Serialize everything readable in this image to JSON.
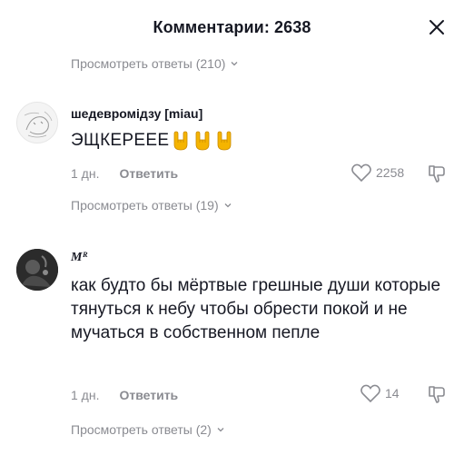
{
  "header": {
    "title": "Комментарии: 2638",
    "close_icon": "close-icon"
  },
  "thread_top": {
    "view_replies": "Просмотреть ответы (210)"
  },
  "comments": [
    {
      "username": "шедевромідзу [miau]",
      "text": "ЭЩКЕРЕЕЕ",
      "emoji": [
        "sign-of-horns",
        "sign-of-horns",
        "sign-of-horns"
      ],
      "time": "1 дн.",
      "reply_label": "Ответить",
      "likes": "2258",
      "view_replies": "Просмотреть ответы (19)"
    },
    {
      "username": "Mᴿ",
      "text": "как будто бы мёртвые грешные души которые тянуться к небу чтобы обрести покой и не мучаться в собственном пепле",
      "time": "1 дн.",
      "reply_label": "Ответить",
      "likes": "14",
      "view_replies": "Просмотреть ответы (2)"
    }
  ],
  "colors": {
    "text_primary": "#161823",
    "text_secondary": "#8a8b91",
    "emoji": "#f5b400"
  }
}
